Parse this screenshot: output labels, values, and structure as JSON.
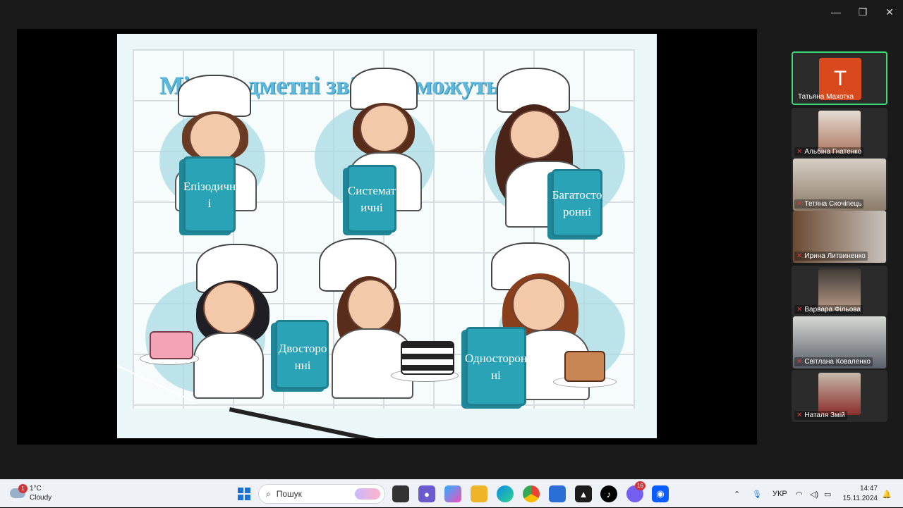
{
  "window": {
    "controls": [
      "—",
      "❐",
      "✕"
    ]
  },
  "slide": {
    "title": "Міжпредметні зв’язки можутьбути:",
    "labels": {
      "episodic": "Епізодичні",
      "systematic": "Систематичні",
      "multilateral": "Багатосторонні",
      "bilateral": "Двосторонні",
      "unilateral": "Односторонні"
    },
    "colors": {
      "title": "#5fb8dc",
      "scroll": "#2aa3b6"
    }
  },
  "participants": [
    {
      "name": "Татьяна Махотка",
      "avatar_letter": "T",
      "muted": false,
      "active": true
    },
    {
      "name": "Альбіна Гнатенко",
      "muted": true
    },
    {
      "name": "Тетяна Скочіпець",
      "muted": true
    },
    {
      "name": "Ирина Литвиненко",
      "muted": true
    },
    {
      "name": "Варвара Фільова",
      "muted": true
    },
    {
      "name": "Світлана Коваленко",
      "muted": true
    },
    {
      "name": "Наталя Змій",
      "muted": true
    }
  ],
  "taskbar": {
    "weather_temp": "1°C",
    "weather_desc": "Cloudy",
    "weather_badge": "1",
    "search_placeholder": "Пошук",
    "viber_badge": "16",
    "language": "УКР",
    "time": "14:47",
    "date": "15.11.2024"
  }
}
